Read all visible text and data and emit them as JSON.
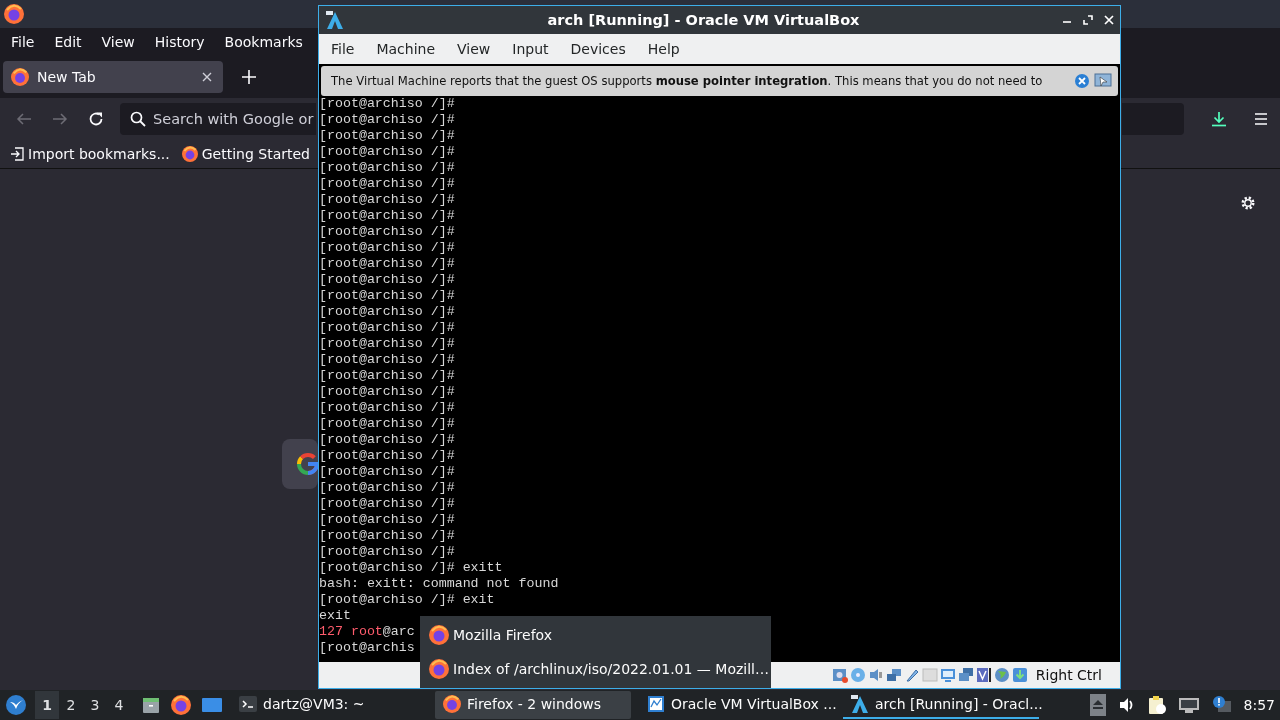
{
  "firefox": {
    "menu": [
      "File",
      "Edit",
      "View",
      "History",
      "Bookmarks"
    ],
    "tabs": [
      {
        "label": "New Tab",
        "selected": true
      }
    ],
    "search": {
      "placeholder": "Search with Google or"
    },
    "bookmarks": [
      "Import bookmarks...",
      "Getting Started"
    ]
  },
  "virtualbox": {
    "title": "arch [Running] - Oracle VM VirtualBox",
    "menu": [
      "File",
      "Machine",
      "View",
      "Input",
      "Devices",
      "Help"
    ],
    "notification": "The Virtual Machine reports that the guest OS supports **mouse pointer integration**. This means that you do not need to",
    "terminal": [
      {
        "text": "[root@archiso /]#"
      },
      {
        "text": "[root@archiso /]#"
      },
      {
        "text": "[root@archiso /]#"
      },
      {
        "text": "[root@archiso /]#"
      },
      {
        "text": "[root@archiso /]#"
      },
      {
        "text": "[root@archiso /]#"
      },
      {
        "text": "[root@archiso /]#"
      },
      {
        "text": "[root@archiso /]#"
      },
      {
        "text": "[root@archiso /]#"
      },
      {
        "text": "[root@archiso /]#"
      },
      {
        "text": "[root@archiso /]#"
      },
      {
        "text": "[root@archiso /]#"
      },
      {
        "text": "[root@archiso /]#"
      },
      {
        "text": "[root@archiso /]#"
      },
      {
        "text": "[root@archiso /]#"
      },
      {
        "text": "[root@archiso /]#"
      },
      {
        "text": "[root@archiso /]#"
      },
      {
        "text": "[root@archiso /]#"
      },
      {
        "text": "[root@archiso /]#"
      },
      {
        "text": "[root@archiso /]#"
      },
      {
        "text": "[root@archiso /]#"
      },
      {
        "text": "[root@archiso /]#"
      },
      {
        "text": "[root@archiso /]#"
      },
      {
        "text": "[root@archiso /]#"
      },
      {
        "text": "[root@archiso /]#"
      },
      {
        "text": "[root@archiso /]#"
      },
      {
        "text": "[root@archiso /]#"
      },
      {
        "text": "[root@archiso /]#"
      },
      {
        "text": "[root@archiso /]#"
      },
      {
        "text": "[root@archiso /]# exitt"
      },
      {
        "text": "bash: exitt: command not found"
      },
      {
        "text": "[root@archiso /]# exit"
      },
      {
        "text": "exit"
      },
      {
        "parts": [
          {
            "text": "127 root",
            "kind": "error"
          },
          {
            "text": "@arc",
            "kind": "plain"
          }
        ]
      },
      {
        "text": "[root@archis"
      }
    ],
    "host_key": "Right Ctrl"
  },
  "task_menu": {
    "items": [
      "Mozilla Firefox",
      "Index of /archlinux/iso/2022.01.01 — Mozill…"
    ]
  },
  "taskbar": {
    "desktops": [
      {
        "label": "1",
        "selected": true
      },
      {
        "label": "2",
        "selected": false
      },
      {
        "label": "3",
        "selected": false
      },
      {
        "label": "4",
        "selected": false
      }
    ],
    "tasks": [
      {
        "label": "dartz@VM3: ~",
        "kind": "terminal",
        "selected": false,
        "highlighted": false
      },
      {
        "label": "Firefox - 2 windows",
        "kind": "browser",
        "selected": false,
        "highlighted": true
      },
      {
        "label": "Oracle VM VirtualBox ...",
        "kind": "monitor",
        "selected": false,
        "highlighted": false
      },
      {
        "label": "arch [Running] - Oracl...",
        "kind": "vm",
        "selected": true,
        "highlighted": false
      }
    ],
    "clock": "8:57"
  }
}
